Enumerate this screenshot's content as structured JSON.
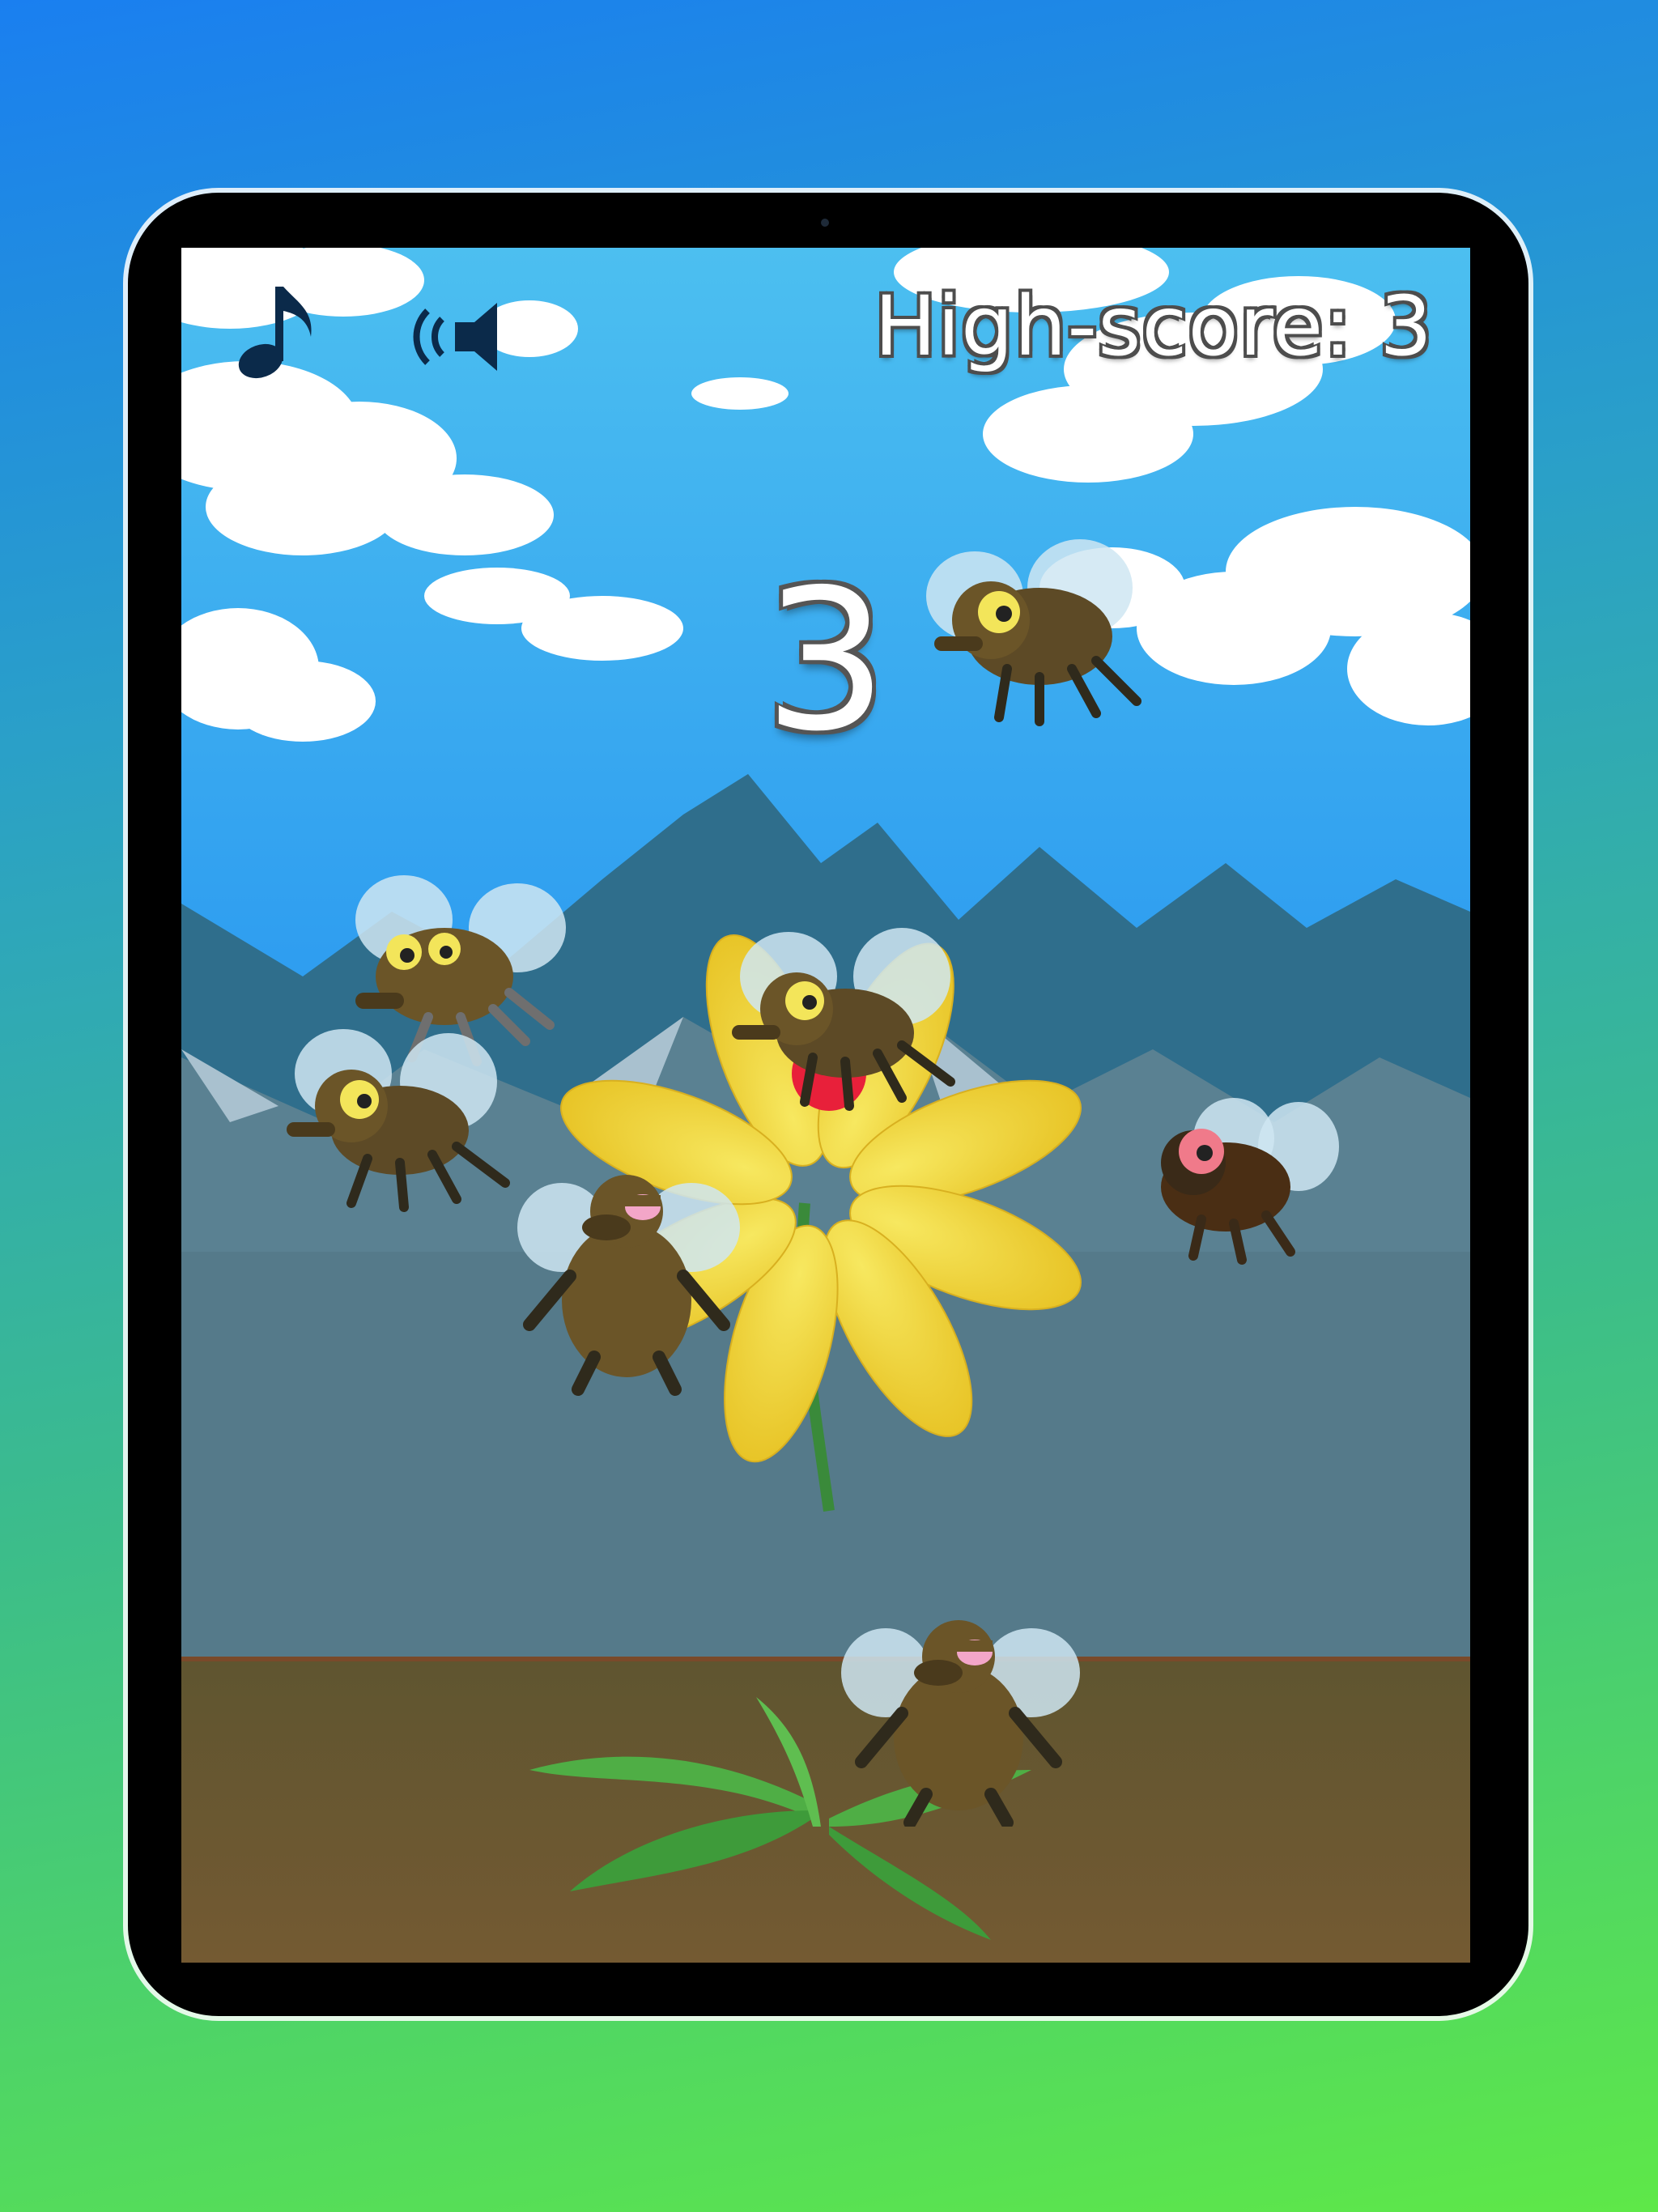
{
  "app": {
    "device": "tablet",
    "background_gradient": [
      "#1a7ff0",
      "#5ee848"
    ]
  },
  "hud": {
    "music_icon": "music-note-icon",
    "sound_icon": "speaker-icon",
    "high_score_label": "High-score: 3",
    "score": "3"
  },
  "scene": {
    "sky_color": "#41b6ee",
    "mountain_colors": [
      "#2f6e8c",
      "#5a8192",
      "#9fb7c6"
    ],
    "ground_color": "#6b5a30",
    "flower_petal_color": "#f2d22a",
    "flower_center_color": "#e8203a"
  },
  "flies": [
    {
      "kind": "yellow-eyed",
      "name": "fly-1"
    },
    {
      "kind": "yellow-eyed",
      "name": "fly-2"
    },
    {
      "kind": "yellow-eyed",
      "name": "fly-3"
    },
    {
      "kind": "yellow-eyed",
      "name": "fly-4"
    },
    {
      "kind": "red-eyed",
      "name": "fly-5"
    },
    {
      "kind": "sleepy",
      "name": "fly-6"
    },
    {
      "kind": "sleepy",
      "name": "fly-7"
    }
  ]
}
